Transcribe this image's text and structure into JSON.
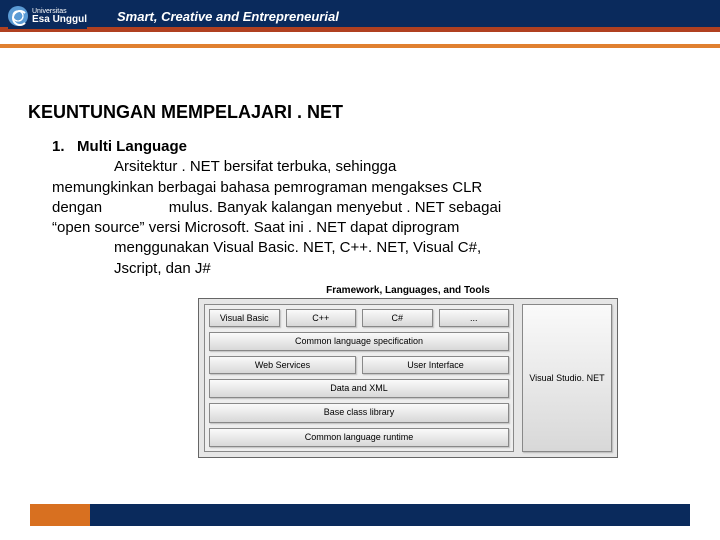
{
  "header": {
    "university_small": "Universitas",
    "university_name": "Esa Unggul",
    "tagline": "Smart, Creative and Entrepreneurial"
  },
  "title": "KEUNTUNGAN MEMPELAJARI . NET",
  "list": {
    "num": "1.",
    "heading": "Multi Language",
    "line1": "Arsitektur . NET bersifat terbuka, sehingga",
    "line2": "memungkinkan  berbagai bahasa pemrograman mengakses CLR",
    "line3": "dengan                mulus. Banyak kalangan menyebut . NET sebagai",
    "line4": "“open    source” versi Microsoft. Saat ini . NET dapat diprogram",
    "line5": "menggunakan Visual Basic. NET, C++. NET, Visual C#,",
    "line6": "Jscript, dan J#"
  },
  "diagram": {
    "title": "Framework, Languages, and Tools",
    "row1": [
      "Visual Basic",
      "C++",
      "C#",
      "..."
    ],
    "row2": "Common language specification",
    "row3": [
      "Web Services",
      "User Interface"
    ],
    "row4": "Data and XML",
    "row5": "Base class library",
    "row6": "Common language runtime",
    "right": "Visual Studio. NET"
  }
}
